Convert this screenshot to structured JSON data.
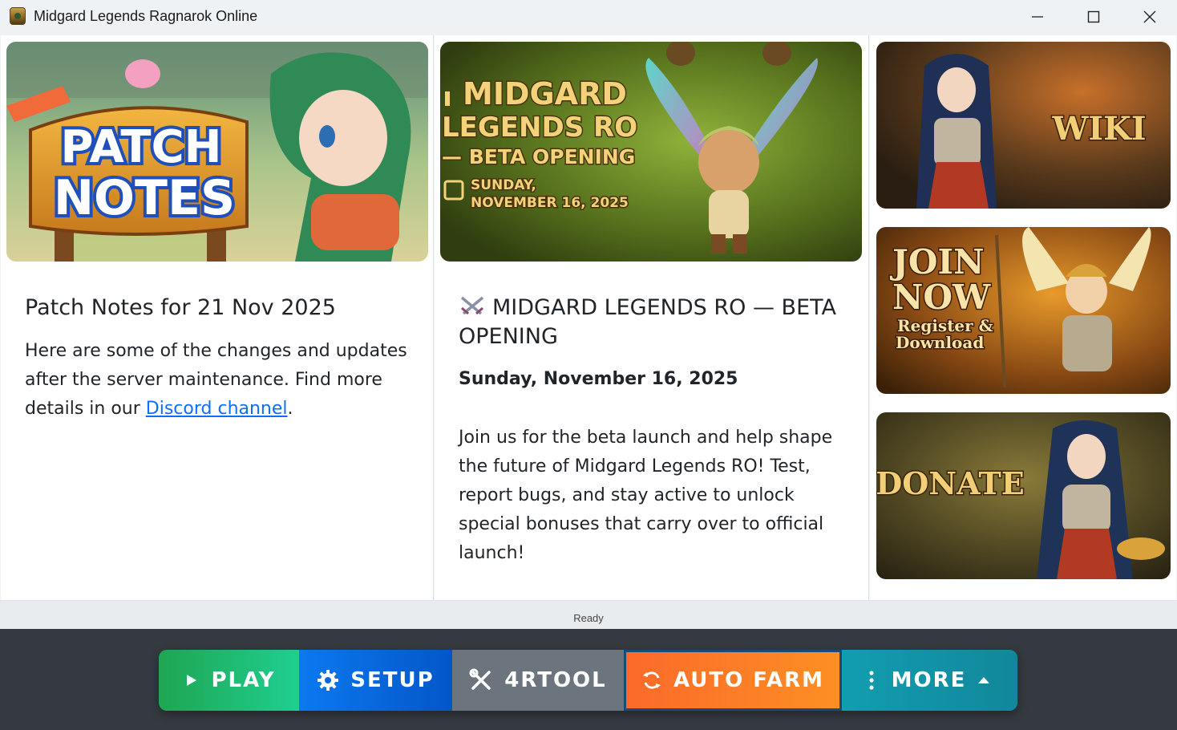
{
  "window": {
    "title": "Midgard Legends Ragnarok Online",
    "icons": {
      "app": "app-logo-icon",
      "minimize": "minimize-icon",
      "maximize": "maximize-icon",
      "close": "close-icon"
    }
  },
  "left_panel": {
    "banner": {
      "line1": "PATCH",
      "line2": "NOTES"
    },
    "title": "Patch Notes for 21 Nov 2025",
    "body_before_link": "Here are some of the changes and updates after the server maintenance. Find more details in our ",
    "link_text": "Discord channel",
    "body_after_link": "."
  },
  "mid_panel": {
    "banner": {
      "line1": "MIDGARD",
      "line2": "LEGENDS RO",
      "line3": "— BETA OPENING",
      "date_line1": "SUNDAY,",
      "date_line2": "NOVEMBER 16, 2025"
    },
    "title_icon": "crossed-swords-icon",
    "title": "MIDGARD LEGENDS RO — BETA OPENING",
    "date": "Sunday, November 16, 2025",
    "body": "Join us for the beta launch and help shape the future of Midgard Legends RO! Test, report bugs, and stay active to unlock special bonuses that carry over to official launch!"
  },
  "right_panel": {
    "wiki": {
      "label": "WIKI"
    },
    "join": {
      "line1": "JOIN",
      "line2": "NOW",
      "line3": "Register &",
      "line4": "Download"
    },
    "donate": {
      "label": "DONATE"
    }
  },
  "status": {
    "text": "Ready"
  },
  "toolbar": {
    "play": {
      "label": "PLAY",
      "icon": "play-icon",
      "color": "#1fb86f"
    },
    "setup": {
      "label": "SETUP",
      "icon": "gear-icon",
      "color": "#0b6fe6"
    },
    "tool": {
      "label": "4RTOOL",
      "icon": "tools-icon",
      "color": "#6c757d"
    },
    "farm": {
      "label": "AUTO FARM",
      "icon": "refresh-icon",
      "color": "#fd7e28"
    },
    "more": {
      "label": "MORE",
      "icon": "more-icon",
      "color": "#1295a8"
    }
  }
}
